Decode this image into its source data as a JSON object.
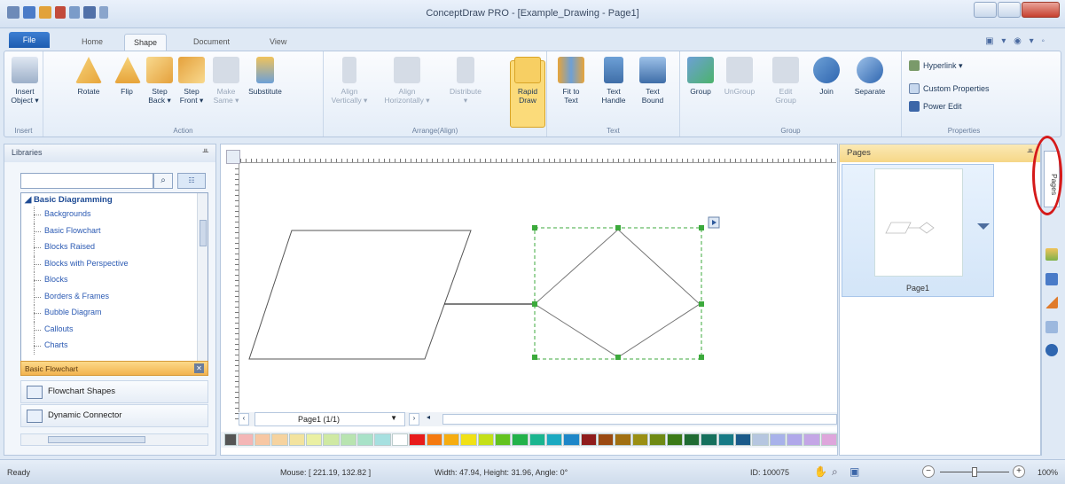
{
  "window": {
    "title": "ConceptDraw PRO - [Example_Drawing - Page1]"
  },
  "tabs": {
    "file": "File",
    "home": "Home",
    "shape": "Shape",
    "document": "Document",
    "view": "View",
    "right_icons": "▣ ▾ ◉ ▾ ◦"
  },
  "ribbon": {
    "insert": {
      "label": "Insert\nObject ▾",
      "group": "Insert"
    },
    "action": {
      "group": "Action",
      "rotate": "Rotate",
      "flip": "Flip",
      "step_back": "Step\nBack ▾",
      "step_front": "Step\nFront ▾",
      "make_same": "Make\nSame ▾",
      "substitute": "Substitute"
    },
    "arrange": {
      "group": "Arrange(Align)",
      "align_v": "Align\nVertically ▾",
      "align_h": "Align\nHorizontally ▾",
      "distribute": "Distribute",
      "rapid_draw": "Rapid\nDraw"
    },
    "text": {
      "group": "Text",
      "fit_to_text": "Fit to\nText",
      "text_handle": "Text\nHandle",
      "text_bound": "Text\nBound"
    },
    "group_g": {
      "group": "Group",
      "ungroup": "UnGroup",
      "edit_group": "Edit\nGroup",
      "join": "Join",
      "separate": "Separate"
    },
    "properties": {
      "group": "Properties",
      "hyperlink": "Hyperlink ▾",
      "custom": "Custom Properties",
      "power_edit": "Power Edit"
    }
  },
  "libraries": {
    "title": "Libraries",
    "search_placeholder": "",
    "root": "◢ Basic Diagramming",
    "items": [
      "Backgrounds",
      "Basic Flowchart",
      "Blocks Raised",
      "Blocks with Perspective",
      "Blocks",
      "Borders & Frames",
      "Bubble Diagram",
      "Callouts",
      "Charts"
    ],
    "open_library": "Basic Flowchart",
    "lib_items": [
      "Flowchart Shapes",
      "Dynamic Connector"
    ]
  },
  "canvas": {
    "page_selector": "Page1 (1/1)"
  },
  "pages_panel": {
    "title": "Pages",
    "page_label": "Page1",
    "sidebar_tab": "Pages"
  },
  "palette": {
    "colors": [
      "#f4b6b6",
      "#f7c7a3",
      "#f6d39f",
      "#f3e39e",
      "#eaf0a3",
      "#cfe9a3",
      "#b8e4b0",
      "#a8e2c8",
      "#a6e0e0",
      "#ffffff",
      "#e81c1c",
      "#f57a10",
      "#f6ad10",
      "#f1e116",
      "#c4e018",
      "#63c31f",
      "#22b24a",
      "#1ab58f",
      "#1aa9c1",
      "#1d86c8",
      "#8f1c1c",
      "#9b4a12",
      "#a17012",
      "#9a8f14",
      "#6f8a14",
      "#3b7a17",
      "#1f6b33",
      "#15705d",
      "#167a86",
      "#1a5a8a",
      "#b6c6e0",
      "#a8b2ea",
      "#b0a8ea",
      "#c4a6e6",
      "#dea6dc"
    ]
  },
  "status": {
    "ready": "Ready",
    "mouse": "Mouse: [ 221.19, 132.82 ]",
    "size": "Width: 47.94,  Height: 31.96,  Angle: 0°",
    "id": "ID: 100075",
    "zoom": "100%"
  }
}
